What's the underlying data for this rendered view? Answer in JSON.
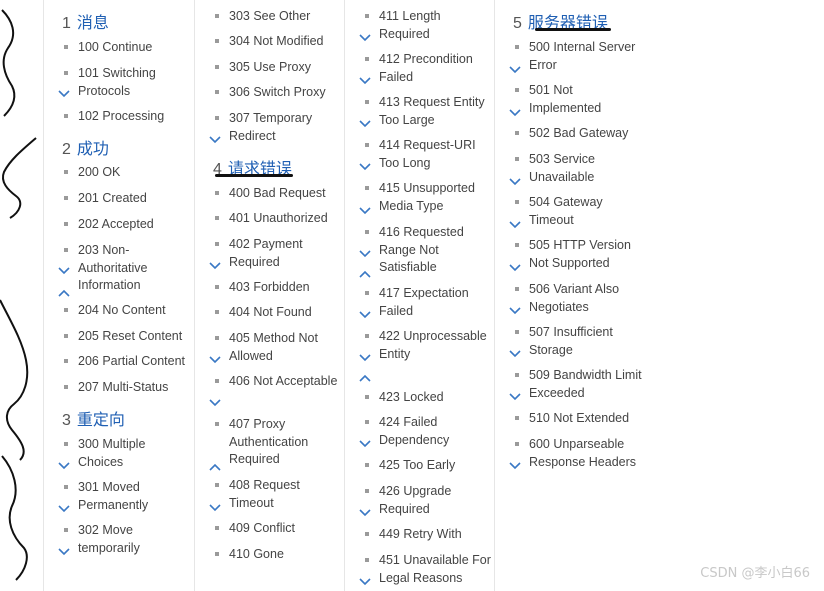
{
  "sections": [
    {
      "num": "1",
      "title": "消息"
    },
    {
      "num": "2",
      "title": "成功"
    },
    {
      "num": "3",
      "title": "重定向"
    },
    {
      "num": "4",
      "title": "请求错误"
    },
    {
      "num": "5",
      "title": "服务器错误"
    }
  ],
  "items": {
    "c100": "100 Continue",
    "c101": "101 Switching Protocols",
    "c102": "102 Processing",
    "c200": "200 OK",
    "c201": "201 Created",
    "c202": "202 Accepted",
    "c203": "203 Non-Authoritative Information",
    "c204": "204 No Content",
    "c205": "205 Reset Content",
    "c206": "206 Partial Content",
    "c207": "207 Multi-Status",
    "c300": "300 Multiple Choices",
    "c301": "301 Moved Permanently",
    "c302": "302 Move temporarily",
    "c303": "303 See Other",
    "c304": "304 Not Modified",
    "c305": "305 Use Proxy",
    "c306": "306 Switch Proxy",
    "c307": "307 Temporary Redirect",
    "c400": "400 Bad Request",
    "c401": "401 Unauthorized",
    "c402": "402 Payment Required",
    "c403": "403 Forbidden",
    "c404": "404 Not Found",
    "c405": "405 Method Not Allowed",
    "c406": "406 Not Acceptable",
    "c407": "407 Proxy Authentication Required",
    "c408": "408 Request Timeout",
    "c409": "409 Conflict",
    "c410": "410 Gone",
    "c411": "411 Length Required",
    "c412": "412 Precondition Failed",
    "c413": "413 Request Entity Too Large",
    "c414": "414 Request-URI Too Long",
    "c415": "415 Unsupported Media Type",
    "c416": "416 Requested Range Not Satisfiable",
    "c417": "417 Expectation Failed",
    "c422": "422 Unprocessable Entity",
    "c423": "423 Locked",
    "c424": "424 Failed Dependency",
    "c425": "425 Too Early",
    "c426": "426 Upgrade Required",
    "c449": "449 Retry With",
    "c451": "451 Unavailable For Legal Reasons",
    "c500": "500 Internal Server Error",
    "c501": "501 Not Implemented",
    "c502": "502 Bad Gateway",
    "c503": "503 Service Unavailable",
    "c504": "504 Gateway Timeout",
    "c505": "505 HTTP Version Not Supported",
    "c506": "506 Variant Also Negotiates",
    "c507": "507 Insufficient Storage",
    "c509": "509 Bandwidth Limit Exceeded",
    "c510": "510 Not Extended",
    "c600": "600 Unparseable Response Headers"
  },
  "watermark": "CSDN @李小白66",
  "colors": {
    "heading": "#1f5fb3",
    "chevron": "#3a78c4",
    "divider": "#e6e6e6"
  }
}
